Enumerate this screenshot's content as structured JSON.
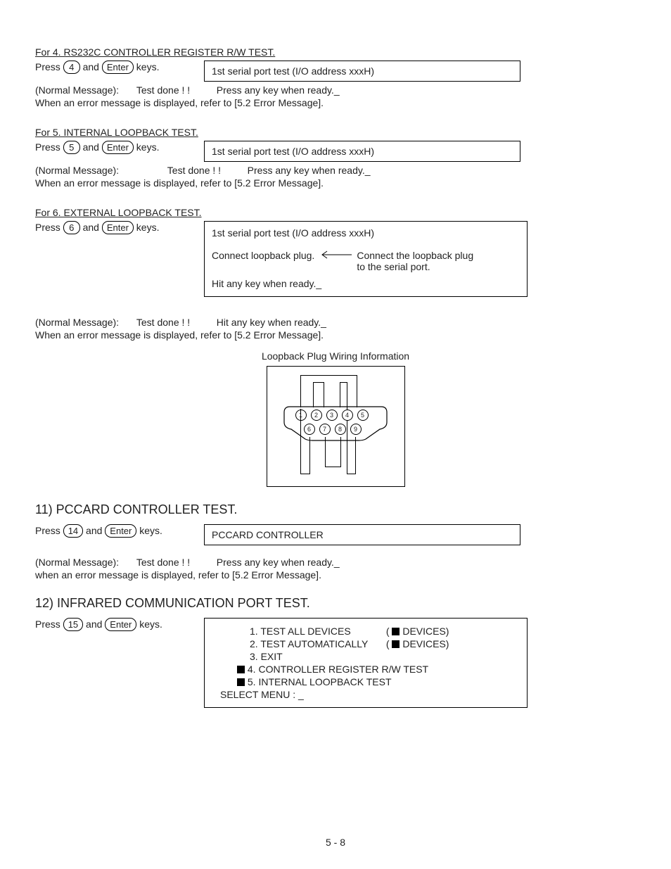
{
  "sec4": {
    "title": "For 4.  RS232C CONTROLLER REGISTER R/W TEST.",
    "press_prefix": "Press",
    "key1": "4",
    "press_mid": "and",
    "key2": "Enter",
    "press_suffix": "keys.",
    "box_line1": "1st serial port test (I/O address xxxH)",
    "normal_label": "(Normal Message):",
    "normal_done": "Test done ! !",
    "normal_prompt": "Press any key when ready._",
    "error_note": "When an error message is displayed, refer to [5.2 Error Message]."
  },
  "sec5": {
    "title": "For  5.  INTERNAL LOOPBACK TEST.",
    "press_prefix": "Press",
    "key1": "5",
    "press_mid": "and",
    "key2": "Enter",
    "press_suffix": "keys.",
    "box_line1": "1st serial port test (I/O address xxxH)",
    "normal_label": "(Normal Message):",
    "normal_done": "Test done ! !",
    "normal_prompt": "Press any key when ready._",
    "error_note": "When an error message is displayed, refer to [5.2 Error Message]."
  },
  "sec6": {
    "title": "For  6.  EXTERNAL LOOPBACK TEST.",
    "press_prefix": "Press",
    "key1": "6",
    "press_mid": "and",
    "key2": "Enter",
    "press_suffix": "keys.",
    "box_line1": "1st serial port test (I/O address xxxH)",
    "box_line2_left": "Connect loopback plug.",
    "box_line2_right1": "Connect the loopback plug",
    "box_line2_right2": "to the serial port.",
    "box_line3": "Hit any key when ready._",
    "normal_label": "(Normal Message):",
    "normal_done": "Test done ! !",
    "normal_prompt": "Hit any key when ready._",
    "error_note": "When an error message is displayed, refer to [5.2 Error Message].",
    "diagram_title": "Loopback Plug Wiring Information"
  },
  "sec11": {
    "heading": "11)  PCCARD CONTROLLER TEST.",
    "press_prefix": "Press",
    "key1": "14",
    "press_mid": "and",
    "key2": "Enter",
    "press_suffix": "keys.",
    "box_line1": "PCCARD CONTROLLER",
    "normal_label": "(Normal Message):",
    "normal_done": "Test done ! !",
    "normal_prompt": "Press any key when ready._",
    "error_note": "when an error message is displayed, refer to [5.2 Error Message]."
  },
  "sec12": {
    "heading": "12) INFRARED COMMUNICATION PORT TEST.",
    "press_prefix": "Press",
    "key1": "15",
    "press_mid": "and",
    "key2": "Enter",
    "press_suffix": "keys.",
    "menu": {
      "l1a": "1. TEST ALL DEVICES",
      "l1b": "(",
      "l1c": "DEVICES)",
      "l2a": "2. TEST AUTOMATICALLY",
      "l2b": "(",
      "l2c": "DEVICES)",
      "l3": "3. EXIT",
      "l4": "4. CONTROLLER REGISTER R/W TEST",
      "l5": "5. INTERNAL LOOPBACK TEST",
      "select": "SELECT MENU : _"
    }
  },
  "pins": {
    "p1": "1",
    "p2": "2",
    "p3": "3",
    "p4": "4",
    "p5": "5",
    "p6": "6",
    "p7": "7",
    "p8": "8",
    "p9": "9"
  },
  "page_number": "5 - 8"
}
